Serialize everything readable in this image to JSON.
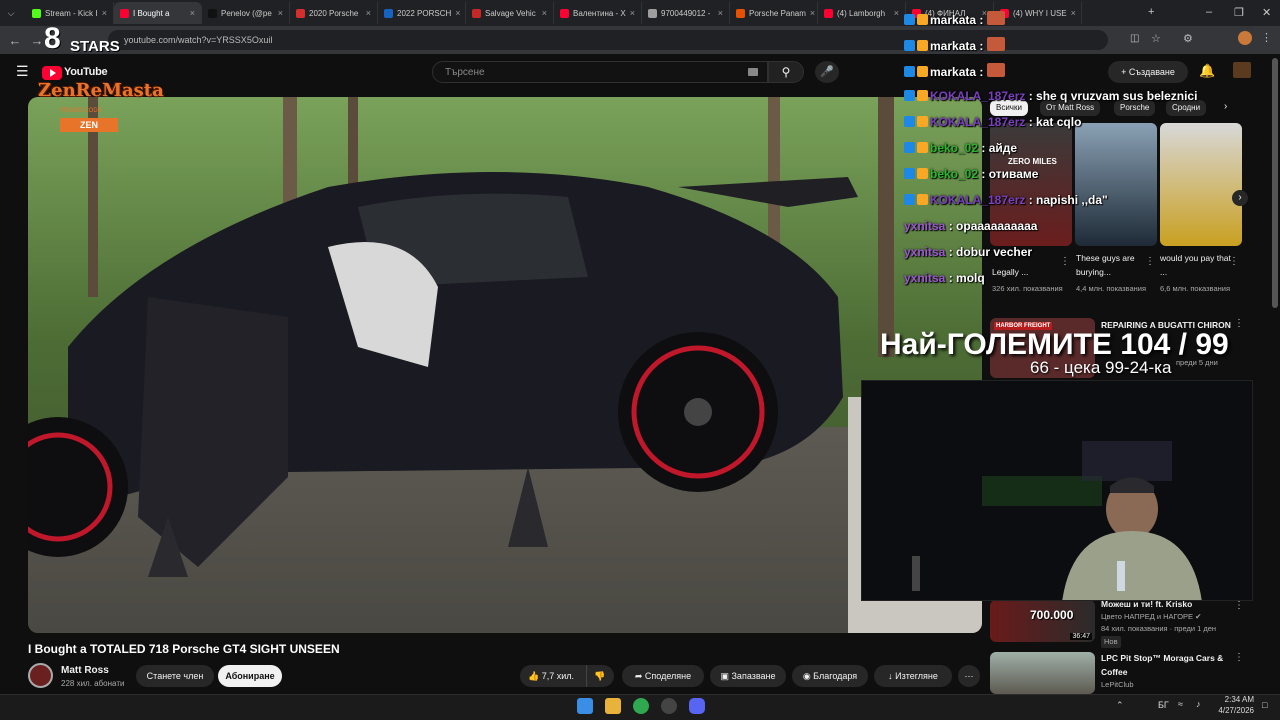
{
  "browser": {
    "tabs": [
      {
        "label": "Stream - Kick I",
        "color": "#53fc18"
      },
      {
        "label": "I Bought a",
        "color": "#ff0033",
        "active": true
      },
      {
        "label": "Penelov (@pe",
        "color": "#111111"
      },
      {
        "label": "2020 Porsche",
        "color": "#d32f2f"
      },
      {
        "label": "2022 PORSCH",
        "color": "#1565c0"
      },
      {
        "label": "Salvage Vehic",
        "color": "#c62828"
      },
      {
        "label": "Валентина - Х",
        "color": "#ff0033"
      },
      {
        "label": "9700449012 -",
        "color": "#9e9e9e"
      },
      {
        "label": "Porsche Panam",
        "color": "#e65100"
      },
      {
        "label": "(4) Lamborgh",
        "color": "#ff0033"
      },
      {
        "label": "(4) ФИНАЛ",
        "color": "#ff0033"
      },
      {
        "label": "(4) WHY I USE",
        "color": "#ff0033"
      }
    ],
    "url": "youtube.com/watch?v=YRSSX5Oxuil"
  },
  "youtube": {
    "logo": "YouTube",
    "search_placeholder": "Търсене",
    "create_label": "Създаване",
    "video_title": "I Bought a TOTALED 718 Porsche GT4 SIGHT UNSEEN",
    "channel_name": "Matt Ross",
    "subscribers": "228 хил. абонати",
    "join_label": "Станете член",
    "subscribe_label": "Абониране",
    "likes": "7,7 хил.",
    "share_label": "Споделяне",
    "save_label": "Запазване",
    "thanks_label": "Благодаря",
    "download_label": "Изтегляне",
    "chips": [
      "Всички",
      "От Matt Ross",
      "Porsche",
      "Сродни"
    ],
    "shorts": [
      {
        "title": "Legally ...",
        "views": "326 хил. показвания",
        "overlay": "ZERO MILES"
      },
      {
        "title": "These guys are burying...",
        "views": "4,4 млн. показвания"
      },
      {
        "title": "would you pay that ...",
        "views": "6,6 млн. показвания"
      }
    ],
    "rec1": {
      "title": "REPAIRING A BUGATTI CHIRON",
      "meta": "преди 5 дни",
      "banner": "HARBOR FREIGHT"
    },
    "rec2": {
      "title": "Можеш и ти! ft. Krisko",
      "channel": "Цвето НАПРЕД и НАГОРЕ",
      "meta": "84 хил. показвания · преди 1 ден",
      "badge": "Нов",
      "duration": "36:47",
      "price": "700.000"
    },
    "rec3": {
      "title": "LPC Pit Stop™ Moraga Cars & Coffee",
      "channel": "LePitClub"
    }
  },
  "overlay": {
    "brand_top": "STARS",
    "brand": "ZenReMasta",
    "promo": "PROMO CODE",
    "promo_code": "ZEN",
    "chat": [
      {
        "user": "markata",
        "msg": "",
        "color": "#ffffff"
      },
      {
        "user": "markata",
        "msg": "",
        "color": "#ffffff"
      },
      {
        "user": "markata",
        "msg": "",
        "color": "#ffffff"
      },
      {
        "user": "KOKALA_187erz",
        "msg": "she q vruzvam sus beleznici",
        "color": "#7b3fbf"
      },
      {
        "user": "KOKALA_187erz",
        "msg": "kat cqlo",
        "color": "#7b3fbf"
      },
      {
        "user": "beko_02",
        "msg": "айде",
        "color": "#2db52d"
      },
      {
        "user": "beko_02",
        "msg": "отиваме",
        "color": "#2db52d"
      },
      {
        "user": "KOKALA_187erz",
        "msg": "napishi ,,da\"",
        "color": "#7b3fbf"
      },
      {
        "user": "yxnitsa",
        "msg": "opaaaaaaaaaa",
        "color": "#9b59d0"
      },
      {
        "user": "yxnitsa",
        "msg": "dobur vecher",
        "color": "#9b59d0"
      },
      {
        "user": "yxnitsa",
        "msg": "molq",
        "color": "#9b59d0"
      }
    ],
    "big_title": "Най-ГОЛЕМИТЕ 104 / 99",
    "sub_line": "66 - цека 99-24-ка"
  },
  "taskbar": {
    "lang": "БГ",
    "time": "2:34 AM",
    "date": "4/27/2026"
  }
}
